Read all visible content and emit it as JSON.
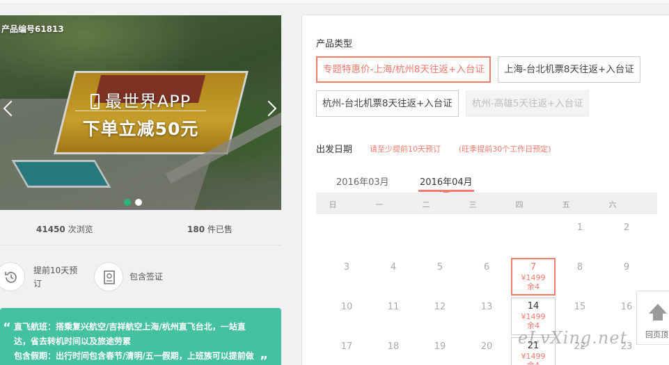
{
  "banner": {
    "product_code": "产品编号61813",
    "promo_line1": "最世界APP",
    "promo_line2": "下单立减50元",
    "carousel_dots": 2,
    "active_dot": 0
  },
  "stats": {
    "views_count": "41450",
    "views_label": " 次浏览",
    "sold_count": "180",
    "sold_label": " 件已售"
  },
  "features": {
    "advance_booking": "提前10天预订",
    "visa_included": "包含签证"
  },
  "highlights": {
    "line1": "直飞航班：搭乘复兴航空/吉祥航空上海/杭州直飞台北，一站直",
    "line2": "达，省去转机时间以及旅途劳累",
    "line3": "包含假期：出行时间包含春节/清明/五一假期，上班族可以提前做"
  },
  "product_type": {
    "title": "产品类型",
    "options": [
      {
        "label": "专题特惠价-上海/杭州8天往返+入台证",
        "state": "selected"
      },
      {
        "label": "上海-台北机票8天往返+入台证",
        "state": "normal"
      },
      {
        "label": "杭州-台北机票8天往返+入台证",
        "state": "normal"
      },
      {
        "label": "杭州-高雄5天往返+入台证",
        "state": "disabled"
      }
    ]
  },
  "departure": {
    "title": "出发日期",
    "note1": "请至少提前10天预订",
    "note2": "(旺季提前30个工作日预定)"
  },
  "calendar": {
    "months": [
      "2016年03月",
      "2016年04月"
    ],
    "active_month": 1,
    "weekdays": [
      "日",
      "一",
      "二",
      "三",
      "四",
      "五",
      "六"
    ],
    "days": [
      [
        "",
        "",
        "",
        "",
        "",
        "1",
        "2"
      ],
      [
        "3",
        "4",
        "5",
        "6",
        "7",
        "8",
        "9"
      ],
      [
        "10",
        "11",
        "12",
        "13",
        "14",
        "15",
        "16"
      ],
      [
        "17",
        "18",
        "19",
        "20",
        "21",
        "22",
        "23"
      ]
    ],
    "available": {
      "7": {
        "price": "¥1499",
        "stock": "余4",
        "selected": true
      },
      "14": {
        "price": "¥1499",
        "stock": "余4",
        "selected": false
      },
      "21": {
        "price": "¥1499",
        "stock": "余4",
        "selected": false
      }
    }
  },
  "back_to_top": {
    "label": "回页顶"
  },
  "watermark": "eLvXing.net",
  "colors": {
    "accent": "#f07a6b",
    "green": "#44c1a0",
    "dot_active": "#2ab47c"
  }
}
